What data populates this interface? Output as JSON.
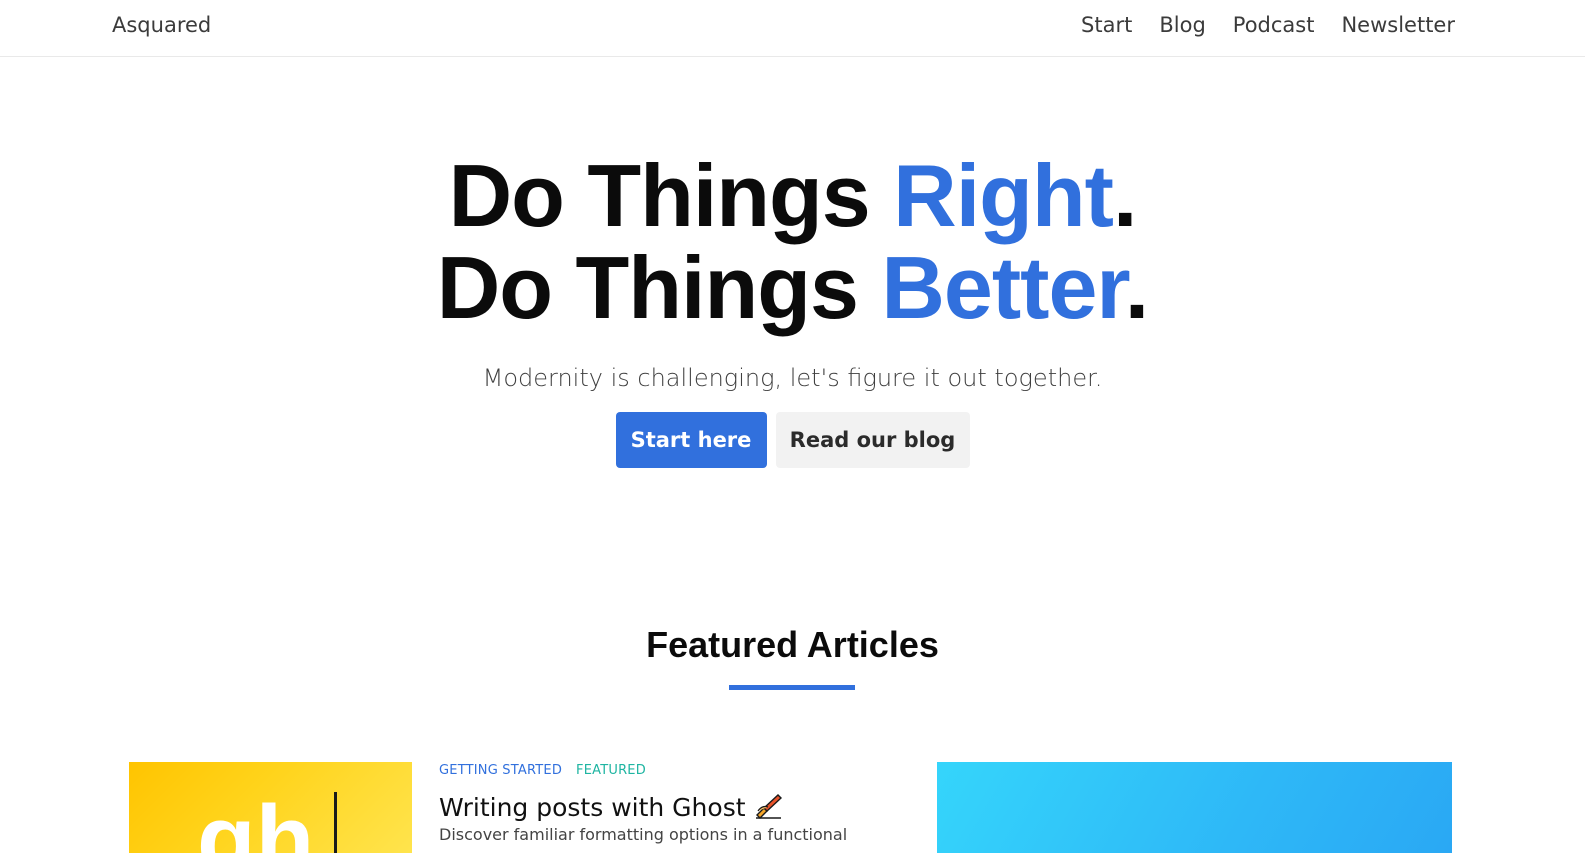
{
  "header": {
    "site_title": "Asquared",
    "nav": [
      {
        "label": "Start"
      },
      {
        "label": "Blog"
      },
      {
        "label": "Podcast"
      },
      {
        "label": "Newsletter"
      }
    ]
  },
  "hero": {
    "line1_prefix": "Do Things ",
    "line1_accent": "Right",
    "line1_suffix": ".",
    "line2_prefix": "Do Things ",
    "line2_accent": "Better",
    "line2_suffix": ".",
    "subtitle": "Modernity is challenging, let's figure it out together.",
    "primary_button": "Start here",
    "secondary_button": "Read our blog"
  },
  "featured": {
    "title": "Featured Articles",
    "cards": [
      {
        "image_text": "gh",
        "tags": [
          "GETTING STARTED",
          "FEATURED"
        ],
        "title": "Writing posts with Ghost",
        "title_icon": "pencil-writing-icon",
        "excerpt": "Discover familiar formatting options in a functional"
      }
    ]
  },
  "colors": {
    "accent": "#3170dd",
    "tag_featured": "#1fb5a2",
    "card1_image": "#ffcd00",
    "card2_image": "#2eb8f7"
  }
}
